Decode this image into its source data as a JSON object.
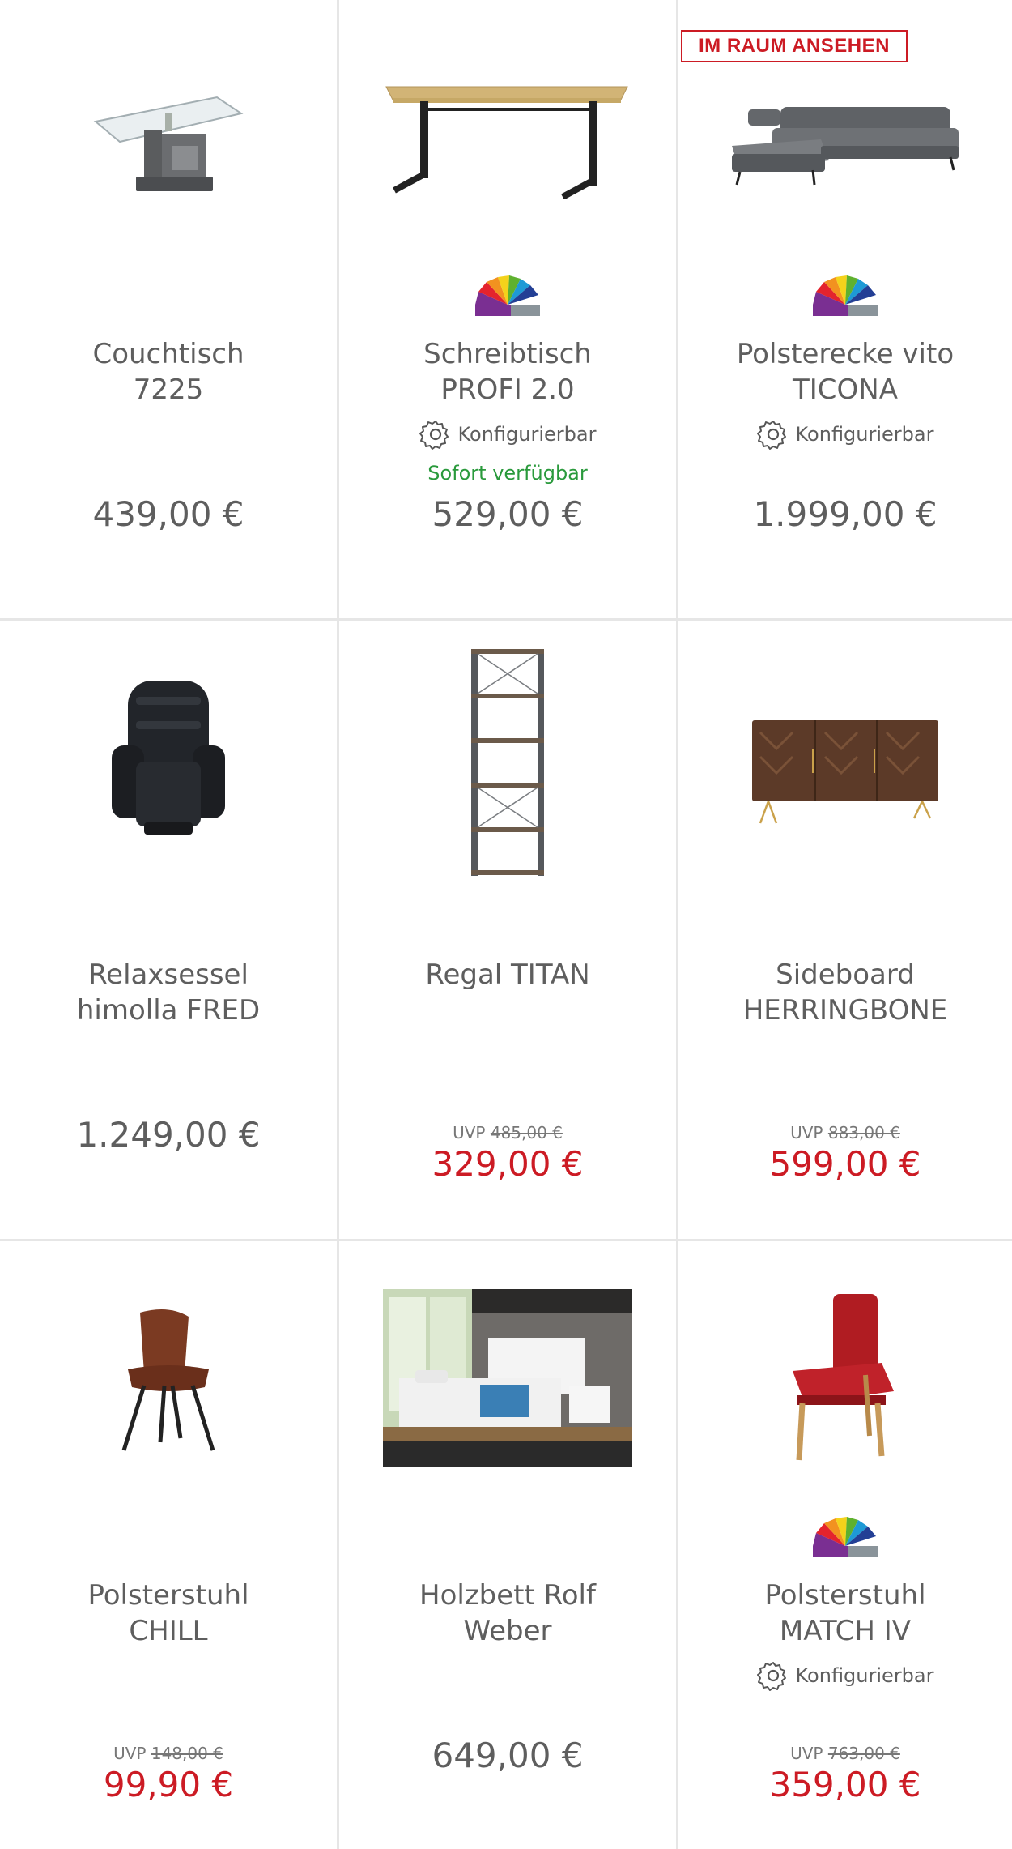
{
  "badge_label": "IM RAUM ANSEHEN",
  "config_label": "Konfigurierbar",
  "uvp_prefix": "UVP",
  "products": [
    {
      "title_lines": [
        "Couchtisch",
        "7225"
      ],
      "price": "439,00 €",
      "icon": "couchtisch-image"
    },
    {
      "title_lines": [
        "Schreibtisch",
        "PROFI 2.0"
      ],
      "configurable": true,
      "availability": "Sofort verfügbar",
      "price": "529,00 €",
      "icon": "schreibtisch-image"
    },
    {
      "title_lines": [
        "Polsterecke vito",
        "TICONA"
      ],
      "configurable": true,
      "price": "1.999,00 €",
      "icon": "polsterecke-image"
    },
    {
      "title_lines": [
        "Relaxsessel",
        "himolla FRED"
      ],
      "price": "1.249,00 €",
      "icon": "relaxsessel-image"
    },
    {
      "title_lines": [
        "Regal TITAN"
      ],
      "uvp_old": "485,00 €",
      "price": "329,00 €",
      "icon": "regal-image"
    },
    {
      "title_lines": [
        "Sideboard",
        "HERRINGBONE"
      ],
      "uvp_old": "883,00 €",
      "price": "599,00 €",
      "icon": "sideboard-image"
    },
    {
      "title_lines": [
        "Polsterstuhl",
        "CHILL"
      ],
      "uvp_old": "148,00 €",
      "price": "99,90 €",
      "icon": "stuhl-chill-image"
    },
    {
      "title_lines": [
        "Holzbett Rolf",
        "Weber"
      ],
      "price": "649,00 €",
      "icon": "holzbett-image"
    },
    {
      "title_lines": [
        "Polsterstuhl",
        "MATCH IV"
      ],
      "configurable": true,
      "uvp_old": "763,00 €",
      "price": "359,00 €",
      "icon": "stuhl-match-image"
    }
  ],
  "colors": {
    "sale": "#cc1b24",
    "available": "#2a9a3c",
    "text": "#5e5e5e",
    "divider": "#e6e6e6"
  }
}
